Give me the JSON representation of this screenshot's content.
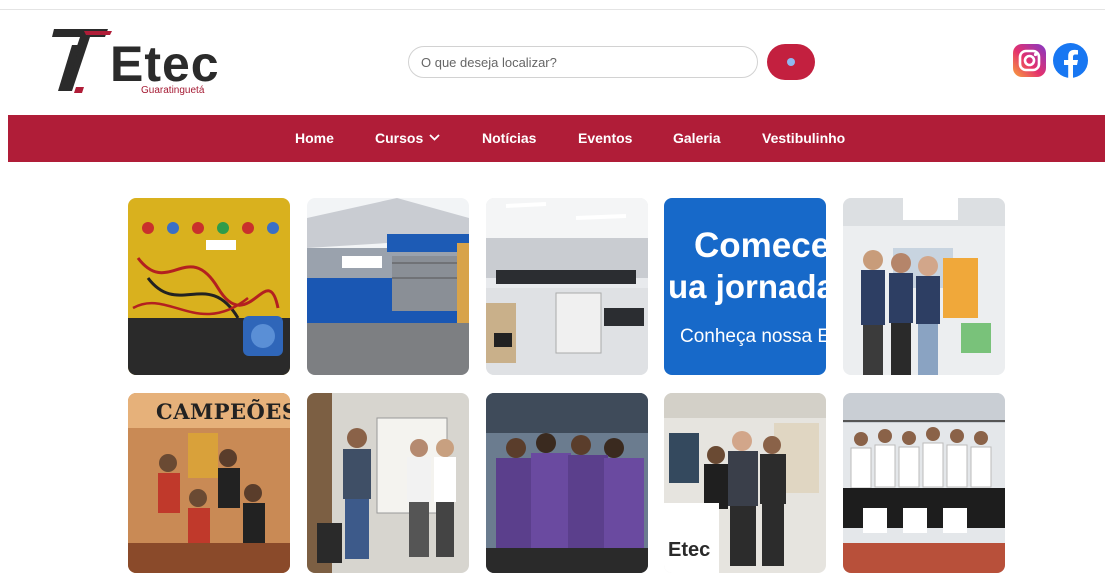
{
  "brand": {
    "name": "Etec",
    "city": "Guaratinguetá",
    "accent": "#b01d38"
  },
  "search": {
    "placeholder": "O que deseja localizar?"
  },
  "social": {
    "icons": [
      "instagram-icon",
      "facebook-icon"
    ]
  },
  "nav": {
    "items": [
      {
        "label": "Home"
      },
      {
        "label": "Cursos",
        "has_dropdown": true
      },
      {
        "label": "Notícias"
      },
      {
        "label": "Eventos"
      },
      {
        "label": "Galeria"
      },
      {
        "label": "Vestibulinho"
      }
    ]
  },
  "gallery": {
    "promo": {
      "line1": "Comece",
      "line2": "ua jornada a",
      "line3": "Conheça nossa E"
    },
    "champions": {
      "title": "CAMPEÕES"
    },
    "sign": {
      "text": "Etec"
    }
  }
}
